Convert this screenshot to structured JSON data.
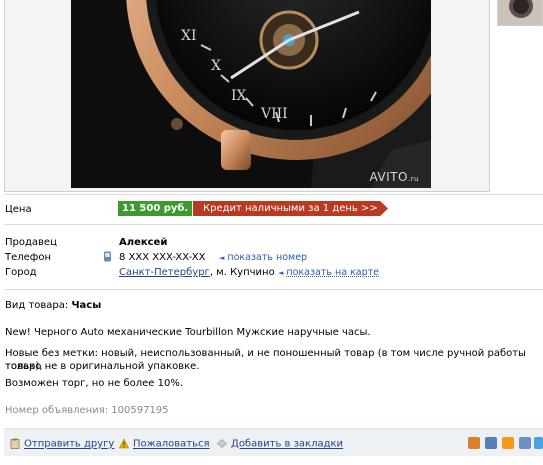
{
  "photo": {
    "watermark_main": "AVITO",
    "watermark_suffix": ".ru"
  },
  "price_row": {
    "label": "Цена",
    "price": "11 500 руб.",
    "credit_button": "Кредит наличными за 1 день >>"
  },
  "seller_row": {
    "label": "Продавец",
    "value": "Алексей"
  },
  "phone_row": {
    "label": "Телефон",
    "value": "8 XXX XXX-XX-XX",
    "link": "показать номер"
  },
  "city_row": {
    "label": "Город",
    "city": "Санкт-Петербург",
    "district": ", м. Купчино",
    "link": "показать на карте"
  },
  "category_row": {
    "label": "Вид товара: ",
    "value": "Часы"
  },
  "description": {
    "line1": "New! Черного Auto механические Tourbillon Мужские наручные часы.",
    "line2a": "Новые без метки: новый, неиспользованный, и не поношенный товар (в том числе ручной работы товар),",
    "line2b": "только не в оригинальной упаковке.",
    "line3": "Возможен торг, но не более 10%."
  },
  "ad_number": "Номер объявления: 100597195",
  "footer": {
    "send_friend": "Отправить другу",
    "complain": "Пожаловаться",
    "bookmark": "Добавить в закладки"
  },
  "colors": {
    "price_green": "#3c9a2e",
    "credit_red": "#b93a22",
    "link_blue": "#22448a",
    "footer_bg": "#eef1f4"
  }
}
